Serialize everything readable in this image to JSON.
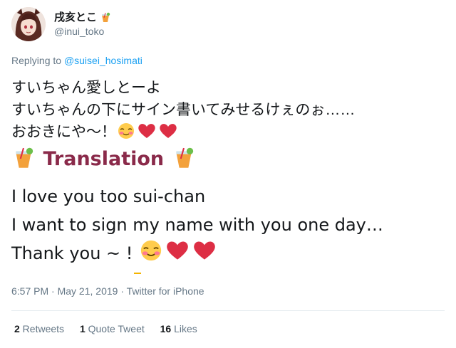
{
  "author": {
    "display_name": "戌亥とこ",
    "handle": "@inui_toko"
  },
  "reply": {
    "prefix": "Replying to ",
    "mention": "@suisei_hosimati"
  },
  "tweet": {
    "jp_lines": [
      "すいちゃん愛しとーよ",
      "すいちゃんの下にサイン書いてみせるけぇのぉ……",
      "おおきにや～！"
    ]
  },
  "translation": {
    "title": "Translation",
    "lines": [
      "I love you too sui-chan",
      "I want to sign my name with you one day…",
      "Thank you ~ !"
    ]
  },
  "meta": {
    "time": "6:57 PM",
    "sep1": " · ",
    "date": "May 21, 2019",
    "sep2": " · ",
    "source": "Twitter for iPhone"
  },
  "stats": {
    "retweets_count": "2",
    "retweets_label": " Retweets",
    "quotes_count": "1",
    "quotes_label": " Quote Tweet",
    "likes_count": "16",
    "likes_label": " Likes"
  },
  "colors": {
    "link": "#1da1f2",
    "muted": "#657786",
    "translation_title": "#8a2a4a",
    "heart": "#dd2e44"
  },
  "icons": [
    "cocktail-icon",
    "smiling-blush-icon",
    "heart-icon"
  ]
}
